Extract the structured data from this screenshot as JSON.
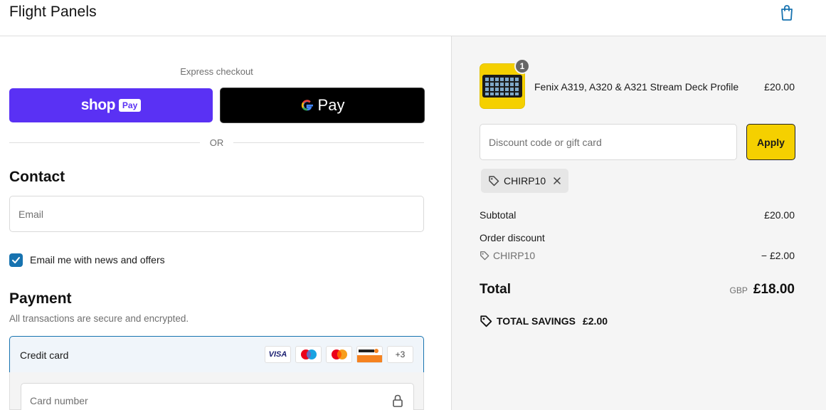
{
  "header": {
    "brand": "Flight Panels",
    "cart_icon": "shopping-bag-icon"
  },
  "express": {
    "label": "Express checkout",
    "shop_pay": {
      "word": "shop",
      "badge": "Pay",
      "color": "#5a31f4"
    },
    "google_pay": {
      "word": "Pay",
      "color": "#000000"
    },
    "or_label": "OR"
  },
  "contact": {
    "title": "Contact",
    "email_placeholder": "Email",
    "news_checkbox": {
      "label": "Email me with news and offers",
      "checked": true
    }
  },
  "payment": {
    "title": "Payment",
    "subtitle": "All transactions are secure and encrypted.",
    "method": "Credit card",
    "card_logos": [
      "visa",
      "maestro",
      "mastercard",
      "discover"
    ],
    "visa_text": "VISA",
    "more_cards": "+3",
    "card_number_placeholder": "Card number"
  },
  "summary": {
    "item": {
      "name": "Fenix A319, A320 & A321 Stream Deck Profile",
      "price": "£20.00",
      "quantity": "1"
    },
    "discount_placeholder": "Discount code or gift card",
    "apply_label": "Apply",
    "applied_code": "CHIRP10",
    "subtotal_label": "Subtotal",
    "subtotal_value": "£20.00",
    "order_discount_label": "Order discount",
    "order_discount_code": "CHIRP10",
    "order_discount_value": "− £2.00",
    "total_label": "Total",
    "currency": "GBP",
    "total_value": "£18.00",
    "savings_label": "TOTAL SAVINGS",
    "savings_value": "£2.00"
  },
  "colors": {
    "accent": "#1773b0",
    "apply_button": "#f5d000",
    "summary_bg": "#f5f5f5"
  }
}
